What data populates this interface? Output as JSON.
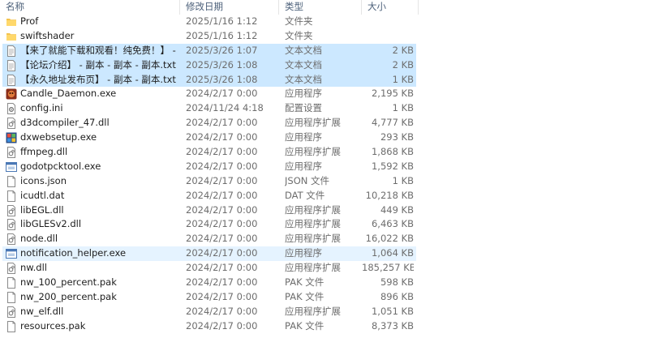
{
  "columns": {
    "name": "名称",
    "date": "修改日期",
    "type": "类型",
    "size": "大小"
  },
  "files": [
    {
      "icon": "folder-icon",
      "name": "Prof",
      "date": "2025/1/16 1:12",
      "type": "文件夹",
      "size": "",
      "state": ""
    },
    {
      "icon": "folder-icon",
      "name": "swiftshader",
      "date": "2025/1/16 1:12",
      "type": "文件夹",
      "size": "",
      "state": ""
    },
    {
      "icon": "text-file-icon",
      "name": "【来了就能下载和观看！纯免费！】 - 副...",
      "date": "2025/3/26 1:07",
      "type": "文本文档",
      "size": "2 KB",
      "state": "selected"
    },
    {
      "icon": "text-file-icon",
      "name": "【论坛介绍】 - 副本 - 副本 - 副本.txt",
      "date": "2025/3/26 1:08",
      "type": "文本文档",
      "size": "2 KB",
      "state": "selected"
    },
    {
      "icon": "text-file-icon",
      "name": "【永久地址发布页】 - 副本 - 副本.txt",
      "date": "2025/3/26 1:08",
      "type": "文本文档",
      "size": "1 KB",
      "state": "selected"
    },
    {
      "icon": "candle-app-icon",
      "name": "Candle_Daemon.exe",
      "date": "2024/2/17 0:00",
      "type": "应用程序",
      "size": "2,195 KB",
      "state": ""
    },
    {
      "icon": "config-file-icon",
      "name": "config.ini",
      "date": "2024/11/24 4:18",
      "type": "配置设置",
      "size": "1 KB",
      "state": ""
    },
    {
      "icon": "dll-file-icon",
      "name": "d3dcompiler_47.dll",
      "date": "2024/2/17 0:00",
      "type": "应用程序扩展",
      "size": "4,777 KB",
      "state": ""
    },
    {
      "icon": "dxsetup-app-icon",
      "name": "dxwebsetup.exe",
      "date": "2024/2/17 0:00",
      "type": "应用程序",
      "size": "293 KB",
      "state": ""
    },
    {
      "icon": "dll-file-icon",
      "name": "ffmpeg.dll",
      "date": "2024/2/17 0:00",
      "type": "应用程序扩展",
      "size": "1,868 KB",
      "state": ""
    },
    {
      "icon": "exe-window-icon",
      "name": "godotpcktool.exe",
      "date": "2024/2/17 0:00",
      "type": "应用程序",
      "size": "1,592 KB",
      "state": ""
    },
    {
      "icon": "generic-file-icon",
      "name": "icons.json",
      "date": "2024/2/17 0:00",
      "type": "JSON 文件",
      "size": "1 KB",
      "state": ""
    },
    {
      "icon": "generic-file-icon",
      "name": "icudtl.dat",
      "date": "2024/2/17 0:00",
      "type": "DAT 文件",
      "size": "10,218 KB",
      "state": ""
    },
    {
      "icon": "dll-file-icon",
      "name": "libEGL.dll",
      "date": "2024/2/17 0:00",
      "type": "应用程序扩展",
      "size": "449 KB",
      "state": ""
    },
    {
      "icon": "dll-file-icon",
      "name": "libGLESv2.dll",
      "date": "2024/2/17 0:00",
      "type": "应用程序扩展",
      "size": "6,463 KB",
      "state": ""
    },
    {
      "icon": "dll-file-icon",
      "name": "node.dll",
      "date": "2024/2/17 0:00",
      "type": "应用程序扩展",
      "size": "16,022 KB",
      "state": ""
    },
    {
      "icon": "exe-window-icon",
      "name": "notification_helper.exe",
      "date": "2024/2/17 0:00",
      "type": "应用程序",
      "size": "1,064 KB",
      "state": "hover"
    },
    {
      "icon": "dll-file-icon",
      "name": "nw.dll",
      "date": "2024/2/17 0:00",
      "type": "应用程序扩展",
      "size": "185,257 KB",
      "state": ""
    },
    {
      "icon": "generic-file-icon",
      "name": "nw_100_percent.pak",
      "date": "2024/2/17 0:00",
      "type": "PAK 文件",
      "size": "598 KB",
      "state": ""
    },
    {
      "icon": "generic-file-icon",
      "name": "nw_200_percent.pak",
      "date": "2024/2/17 0:00",
      "type": "PAK 文件",
      "size": "896 KB",
      "state": ""
    },
    {
      "icon": "dll-file-icon",
      "name": "nw_elf.dll",
      "date": "2024/2/17 0:00",
      "type": "应用程序扩展",
      "size": "1,051 KB",
      "state": ""
    },
    {
      "icon": "generic-file-icon",
      "name": "resources.pak",
      "date": "2024/2/17 0:00",
      "type": "PAK 文件",
      "size": "8,373 KB",
      "state": ""
    }
  ]
}
